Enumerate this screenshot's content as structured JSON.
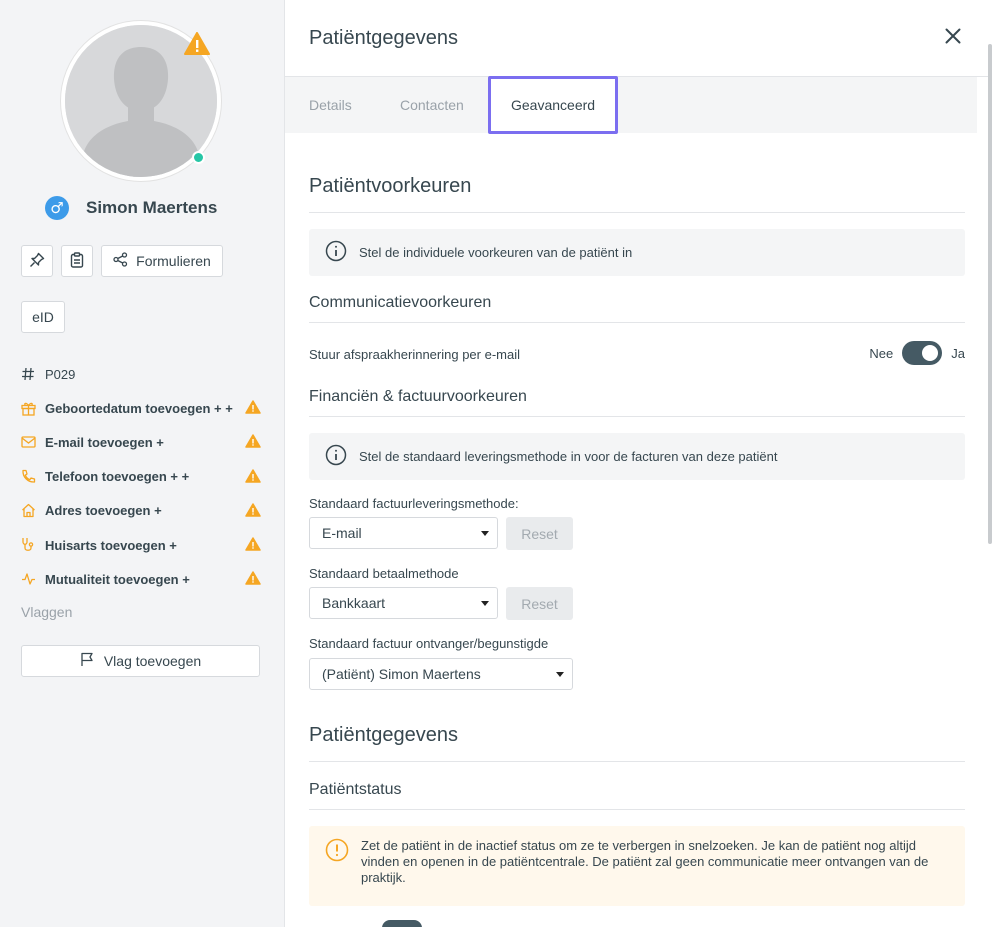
{
  "sidebar": {
    "patient_name": "Simon Maertens",
    "gender_symbol": "♂",
    "forms_button": "Formulieren",
    "eid_button": "eID",
    "patient_id": "P029",
    "items": [
      {
        "label": "Geboortedatum toevoegen + +",
        "icon": "gift-icon"
      },
      {
        "label": "E-mail toevoegen +",
        "icon": "mail-icon"
      },
      {
        "label": "Telefoon toevoegen + +",
        "icon": "phone-icon"
      },
      {
        "label": "Adres toevoegen +",
        "icon": "home-icon"
      },
      {
        "label": "Huisarts toevoegen +",
        "icon": "stethoscope-icon"
      },
      {
        "label": "Mutualiteit toevoegen +",
        "icon": "pulse-icon"
      }
    ],
    "flags_label": "Vlaggen",
    "add_flag_button": "Vlag toevoegen"
  },
  "header": {
    "title": "Patiëntgegevens"
  },
  "tabs": [
    {
      "label": "Details",
      "active": false
    },
    {
      "label": "Contacten",
      "active": false
    },
    {
      "label": "Geavanceerd",
      "active": true
    }
  ],
  "preferences": {
    "title": "Patiëntvoorkeuren",
    "info": "Stel de individuele voorkeuren van de patiënt in",
    "communication_title": "Communicatievoorkeuren",
    "reminder_label": "Stuur afspraakherinnering per e-mail",
    "toggle_no": "Nee",
    "toggle_yes": "Ja",
    "toggle_on": true,
    "finance_title": "Financiën & factuurvoorkeuren",
    "finance_info": "Stel de standaard leveringsmethode in voor de facturen van deze patiënt",
    "delivery_label": "Standaard factuurleveringsmethode:",
    "delivery_value": "E-mail",
    "payment_label": "Standaard betaalmethode",
    "payment_value": "Bankkaart",
    "recipient_label": "Standaard factuur ontvanger/begunstigde",
    "recipient_value": "(Patiënt) Simon Maertens",
    "reset_label": "Reset"
  },
  "patient_data": {
    "title": "Patiëntgegevens",
    "status_title": "Patiëntstatus",
    "status_warning": "Zet de patiënt in de inactief status om ze te verbergen in snelzoeken. Je kan de patiënt nog altijd vinden en openen in de patiëntcentrale. De patiënt zal geen communicatie meer ontvangen van de praktijk."
  },
  "colors": {
    "accent_tab": "#7b6ef0",
    "warning": "#f5a623",
    "online": "#26c6a6",
    "gender": "#3d9be9",
    "toggle": "#455a64"
  }
}
